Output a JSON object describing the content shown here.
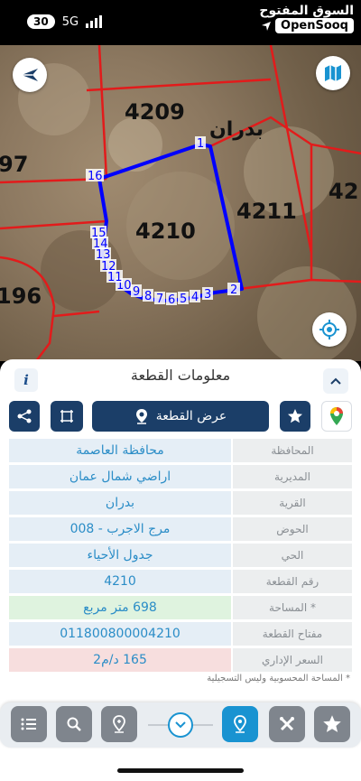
{
  "status_bar": {
    "battery": "30",
    "network": "5G",
    "brand_arabic": "السوق المفتوح",
    "brand_english": "OpenSooq"
  },
  "map": {
    "plot_numbers": {
      "p4209": "4209",
      "p4210": "4210",
      "p4211": "4211",
      "p197": "97",
      "p196": "196",
      "p42": "42"
    },
    "village_label": "بدران",
    "vertex_labels": [
      "1",
      "2",
      "3",
      "4",
      "5",
      "6",
      "7",
      "8",
      "9",
      "10",
      "11",
      "12",
      "13",
      "14",
      "15",
      "16"
    ],
    "colors": {
      "boundary": "#0000ff",
      "parcel_lines": "#e21b1b",
      "label_text": "#111111"
    }
  },
  "panel": {
    "title": "معلومات القطعة",
    "info_label": "i",
    "show_plot_label": "عرض القطعة",
    "rows": [
      {
        "label": "المحافظة",
        "value": "محافظة العاصمة"
      },
      {
        "label": "المديرية",
        "value": "اراضي شمال عمان"
      },
      {
        "label": "القرية",
        "value": "بدران"
      },
      {
        "label": "الحوض",
        "value": "مرج الاجرب - 008"
      },
      {
        "label": "الحي",
        "value": "جدول الأحياء"
      },
      {
        "label": "رقم القطعة",
        "value": "4210"
      },
      {
        "label": "المساحة *",
        "value": "698   متر مربع"
      },
      {
        "label": "مفتاح القطعة",
        "value": "011800800004210"
      },
      {
        "label": "السعر الإداري",
        "value": "165 د/م2"
      }
    ],
    "note": "* المساحة المحسوبية وليس التسجيلية"
  },
  "colors": {
    "accent_dark": "#1b3e68",
    "accent_blue": "#1993d1",
    "value_text": "#2b8dc7",
    "area_bg": "#dff3df",
    "price_bg": "#f7dede"
  }
}
